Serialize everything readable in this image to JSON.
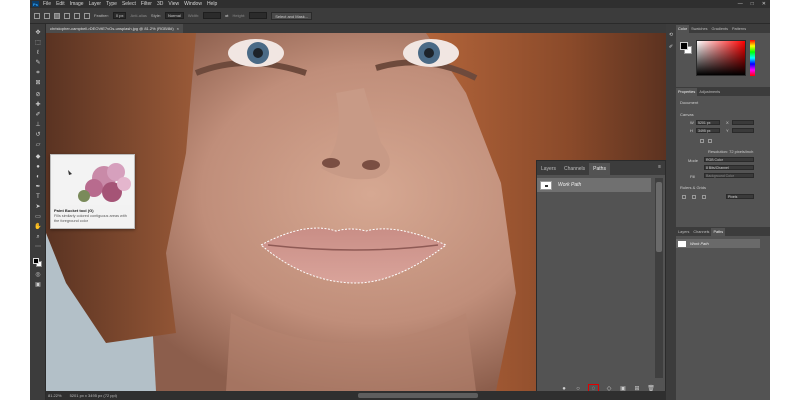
{
  "menubar": {
    "logo": "Ps",
    "items": [
      "File",
      "Edit",
      "Image",
      "Layer",
      "Type",
      "Select",
      "Filter",
      "3D",
      "View",
      "Window",
      "Help"
    ],
    "win_min": "—",
    "win_max": "□",
    "win_close": "✕"
  },
  "options": {
    "feather_label": "Feather:",
    "feather_value": "0 px",
    "antialias_label": "Anti-alias",
    "style_label": "Style:",
    "style_value": "Normal",
    "width_label": "Width:",
    "height_label": "Height:",
    "select_mask_label": "Select and Mask..."
  },
  "document": {
    "tab_title": "christopher-campbell-rDEOVtE7vOs-unsplash.jpg @ 81.2% (RGB/8#)",
    "close": "×"
  },
  "status": {
    "zoom": "81.22%",
    "doc_size": "5201 px x 3495 px (72 ppi)"
  },
  "tooltip": {
    "title": "Paint Bucket tool (G)",
    "description": "Fills similarly colored contiguous areas with the foreground color"
  },
  "paths_panel": {
    "tabs": [
      "Layers",
      "Channels",
      "Paths"
    ],
    "active_tab": "Paths",
    "menu_icon": "≡",
    "work_path": "Work Path",
    "footer_icons": [
      "fill-path-icon",
      "stroke-path-icon",
      "load-selection-icon",
      "make-work-path-icon",
      "add-mask-icon",
      "new-path-icon",
      "delete-path-icon"
    ],
    "highlighted_icon": "load-selection-icon"
  },
  "right": {
    "color_tabs": [
      "Color",
      "Swatches",
      "Gradients",
      "Patterns"
    ],
    "properties_tabs": [
      "Properties",
      "Adjustments"
    ],
    "document_label": "Document",
    "canvas_label": "Canvas",
    "w_label": "W",
    "w_value": "5201 px",
    "h_label": "H",
    "h_value": "3495 px",
    "x_label": "X",
    "y_label": "Y",
    "resolution": "Resolution: 72 pixels/inch",
    "mode_label": "Mode",
    "mode_value": "RGB Color",
    "bit_value": "8 Bits/Channel",
    "fill_label": "Fill",
    "fill_value": "Background Color",
    "rulers_label": "Rulers & Grids",
    "unit_value": "Pixels",
    "lower_tabs": [
      "Layers",
      "Channels",
      "Paths"
    ],
    "lower_work_path": "Work Path"
  },
  "colors": {
    "selection_highlight": "#e00000",
    "accent": "#31a8ff"
  }
}
